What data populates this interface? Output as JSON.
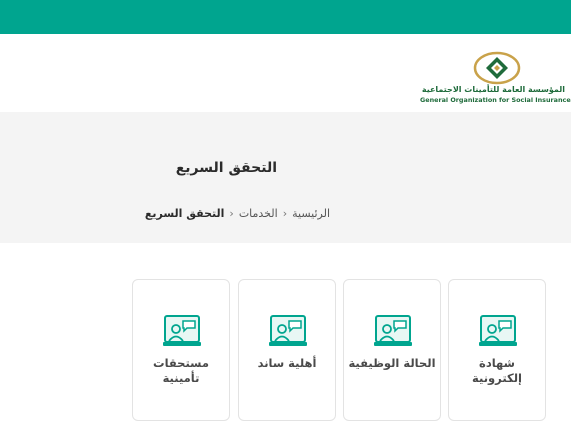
{
  "header": {
    "logo_arabic": "المؤسسة العامة للتأمينات الاجتماعية",
    "logo_english": "General Organization for Social Insurance",
    "brand_color": "#00a58f"
  },
  "hero": {
    "title": "التحقق السريع",
    "breadcrumb": [
      "الرئيسية",
      "الخدمات",
      "التحقق السريع"
    ]
  },
  "cards": [
    {
      "label": "شهادة إلكترونية",
      "icon": "online-support-icon"
    },
    {
      "label": "الحالة الوظيفية",
      "icon": "online-support-icon"
    },
    {
      "label": "أهلية ساند",
      "icon": "online-support-icon"
    },
    {
      "label": "مستحقات تأمينية",
      "icon": "online-support-icon"
    }
  ]
}
